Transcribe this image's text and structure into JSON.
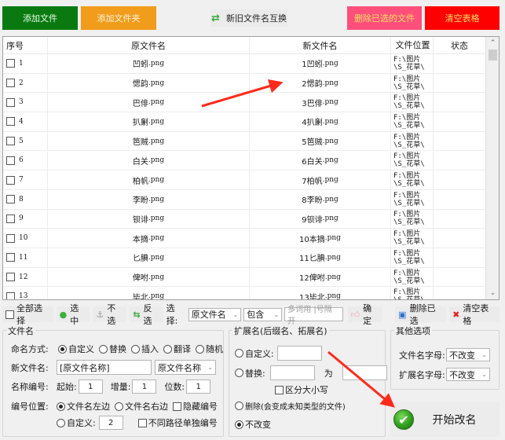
{
  "toolbar": {
    "add_file": "添加文件",
    "add_folder": "添加文件夹",
    "swap_names": "新旧文件名互换",
    "delete_selected": "删除已选的文件",
    "clear_table": "清空表格",
    "colors": {
      "add_file": "#0a7a10",
      "add_folder": "#f19c1b",
      "delete_selected": "#ff4f7a",
      "clear_table": "#ff0000"
    }
  },
  "grid": {
    "headers": {
      "no": "序号",
      "original": "原文件名",
      "new": "新文件名",
      "location": "文件位置",
      "status": "状态"
    },
    "rows": [
      {
        "no": "1",
        "orig": "凹蚓",
        "new": "1凹蚓",
        "ext": ".png",
        "loc": "F:\\图片\\S_花草\\",
        "status": ""
      },
      {
        "no": "2",
        "orig": "愢韵",
        "new": "2愢韵",
        "ext": ".png",
        "loc": "F:\\图片\\S_花草\\",
        "status": ""
      },
      {
        "no": "3",
        "orig": "巴俳",
        "new": "3巴俳",
        "ext": ".png",
        "loc": "F:\\图片\\S_花草\\",
        "status": ""
      },
      {
        "no": "4",
        "orig": "扒劆",
        "new": "4扒劆",
        "ext": ".png",
        "loc": "F:\\图片\\S_花草\\",
        "status": ""
      },
      {
        "no": "5",
        "orig": "笆贼",
        "new": "5笆贼",
        "ext": ".png",
        "loc": "F:\\图片\\S_花草\\",
        "status": ""
      },
      {
        "no": "6",
        "orig": "白关",
        "new": "6白关",
        "ext": ".png",
        "loc": "F:\\图片\\S_花草\\",
        "status": ""
      },
      {
        "no": "7",
        "orig": "柏帆",
        "new": "7柏帆",
        "ext": ".png",
        "loc": "F:\\图片\\S_花草\\",
        "status": ""
      },
      {
        "no": "8",
        "orig": "李盼",
        "new": "8李盼",
        "ext": ".png",
        "loc": "F:\\图片\\S_花草\\",
        "status": ""
      },
      {
        "no": "9",
        "orig": "钡诽",
        "new": "9钡诽",
        "ext": ".png",
        "loc": "F:\\图片\\S_花草\\",
        "status": ""
      },
      {
        "no": "10",
        "orig": "本摘",
        "new": "10本摘",
        "ext": ".png",
        "loc": "F:\\图片\\S_花草\\",
        "status": ""
      },
      {
        "no": "11",
        "orig": "匕腆",
        "new": "11匕腆",
        "ext": ".png",
        "loc": "F:\\图片\\S_花草\\",
        "status": ""
      },
      {
        "no": "12",
        "orig": "俾咐",
        "new": "12俾咐",
        "ext": ".png",
        "loc": "F:\\图片\\S_花草\\",
        "status": ""
      },
      {
        "no": "13",
        "orig": "毕北",
        "new": "13毕北",
        "ext": ".png",
        "loc": "F:\\图片\\S_花草\\",
        "status": ""
      }
    ]
  },
  "selection_bar": {
    "select_all": "全部选择",
    "check": "选中",
    "uncheck": "不选",
    "invert": "反选",
    "select_label": "选择:",
    "field_value": "原文件名",
    "match_value": "包含",
    "keyword_placeholder": "多词用 |号隔开",
    "confirm": "确定",
    "delete_selected": "删除已选",
    "clear_table": "清空表格"
  },
  "filename_group": {
    "title": "文件名",
    "naming_mode_label": "命名方式:",
    "modes": [
      "自定义",
      "替换",
      "插入",
      "翻译",
      "随机"
    ],
    "mode_selected": "自定义",
    "new_name_label": "新文件名:",
    "new_name_value": "[原文件名称]",
    "name_token_value": "原文件名称",
    "numbering_label": "名称编号:",
    "start_label": "起始:",
    "start_value": "1",
    "step_label": "增量:",
    "step_value": "1",
    "digits_label": "位数:",
    "digits_value": "1",
    "position_label": "编号位置:",
    "pos_left": "文件名左边",
    "pos_right": "文件名右边",
    "hide_number": "隐藏编号",
    "pos_custom": "自定义:",
    "pos_custom_value": "2",
    "separate_paths": "不同路径单独编号",
    "position_selected": "文件名左边"
  },
  "extension_group": {
    "title": "扩展名(后缀名、拓展名)",
    "custom_label": "自定义:",
    "custom_value": "",
    "replace_label": "替换:",
    "replace_from": "",
    "replace_to_label": "为",
    "replace_to": "",
    "case_sensitive": "区分大小写",
    "delete_label": "删除(会变成未知类型的文件)",
    "unchanged_label": "不改变",
    "selected": "不改变"
  },
  "other_group": {
    "title": "其他选项",
    "filename_case_label": "文件名字母:",
    "filename_case_value": "不改变",
    "ext_case_label": "扩展名字母:",
    "ext_case_value": "不改变"
  },
  "start_button": {
    "label": "开始改名"
  }
}
